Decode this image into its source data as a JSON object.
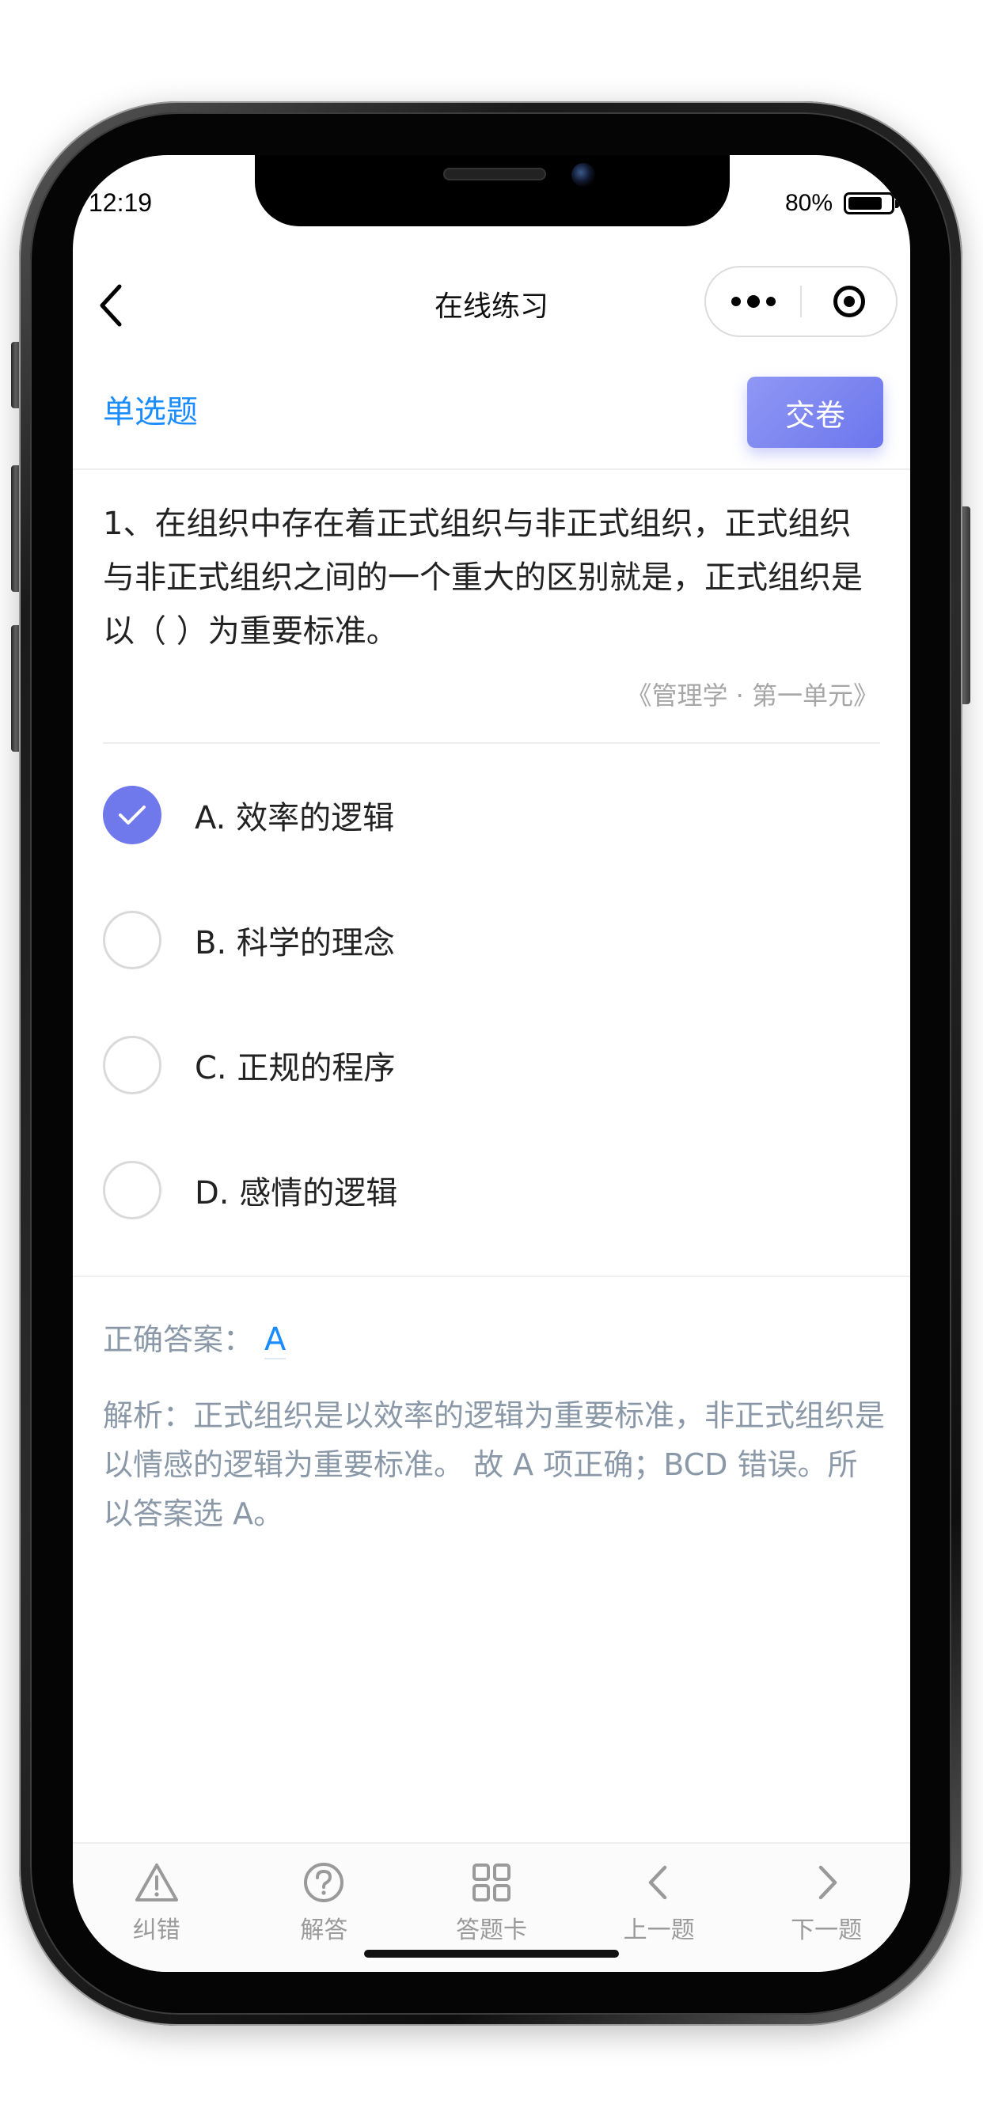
{
  "status_bar": {
    "time": "12:19",
    "battery_percent": "80%",
    "battery_level": 0.8
  },
  "nav": {
    "title": "在线练习",
    "back_icon": "chevron-left-icon",
    "more_icon": "more-dots-icon",
    "close_icon": "target-close-icon"
  },
  "header": {
    "question_type": "单选题",
    "submit_label": "交卷"
  },
  "question": {
    "text": "1、在组织中存在着正式组织与非正式组织，正式组织与非正式组织之间的一个重大的区别就是，正式组织是以（ ）为重要标准。",
    "source": "《管理学 · 第一单元》"
  },
  "options": [
    {
      "label": "A. 效率的逻辑",
      "checked": true
    },
    {
      "label": "B. 科学的理念",
      "checked": false
    },
    {
      "label": "C. 正规的程序",
      "checked": false
    },
    {
      "label": "D. 感情的逻辑",
      "checked": false
    }
  ],
  "answer": {
    "prefix": "正确答案：",
    "value": "A",
    "analysis": "解析：正式组织是以效率的逻辑为重要标准，非正式组织是以情感的逻辑为重要标准。 故 A 项正确；BCD 错误。所以答案选 A。"
  },
  "toolbar": [
    {
      "label": "纠错",
      "icon": "warning-icon"
    },
    {
      "label": "解答",
      "icon": "question-circle-icon"
    },
    {
      "label": "答题卡",
      "icon": "grid-icon"
    },
    {
      "label": "上一题",
      "icon": "chevron-left-icon"
    },
    {
      "label": "下一题",
      "icon": "chevron-right-icon"
    }
  ],
  "colors": {
    "accent_blue": "#1a8cff",
    "button_purple": "#7079ec",
    "muted_text": "#8a98a8"
  }
}
